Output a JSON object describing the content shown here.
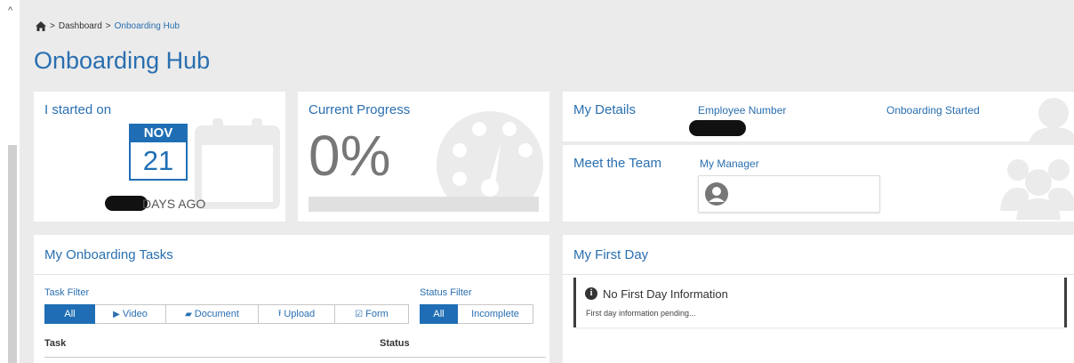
{
  "breadcrumb": {
    "home_icon": "home-icon",
    "separator": ">",
    "items": [
      "Dashboard",
      "Onboarding Hub"
    ]
  },
  "page_title": "Onboarding Hub",
  "started_card": {
    "title": "I started on",
    "month": "NOV",
    "day": "21",
    "days_ago_label": "DAYS AGO"
  },
  "progress_card": {
    "title": "Current Progress",
    "value_text": "0%",
    "progress_fraction": 0
  },
  "details_card": {
    "title": "My Details",
    "employee_number_label": "Employee Number",
    "onboarding_started_label": "Onboarding Started"
  },
  "team_card": {
    "title": "Meet the Team",
    "manager_label": "My Manager"
  },
  "tasks_card": {
    "title": "My Onboarding Tasks",
    "task_filter_label": "Task Filter",
    "task_filters": [
      {
        "label": "All",
        "icon": "",
        "active": true
      },
      {
        "label": "Video",
        "icon": "play-circle-icon",
        "active": false
      },
      {
        "label": "Document",
        "icon": "book-icon",
        "active": false
      },
      {
        "label": "Upload",
        "icon": "upload-icon",
        "active": false
      },
      {
        "label": "Form",
        "icon": "checkbox-icon",
        "active": false
      }
    ],
    "status_filter_label": "Status Filter",
    "status_filters": [
      {
        "label": "All",
        "active": true
      },
      {
        "label": "Incomplete",
        "active": false
      }
    ],
    "columns": [
      "Task",
      "Status"
    ]
  },
  "first_day_card": {
    "title": "My First Day",
    "info_title": "No First Day Information",
    "info_sub": "First day information pending..."
  },
  "colors": {
    "accent": "#2a6fb0",
    "accent_dark": "#1f6eb5",
    "background": "#ebebeb",
    "watermark": "#ebebeb"
  }
}
